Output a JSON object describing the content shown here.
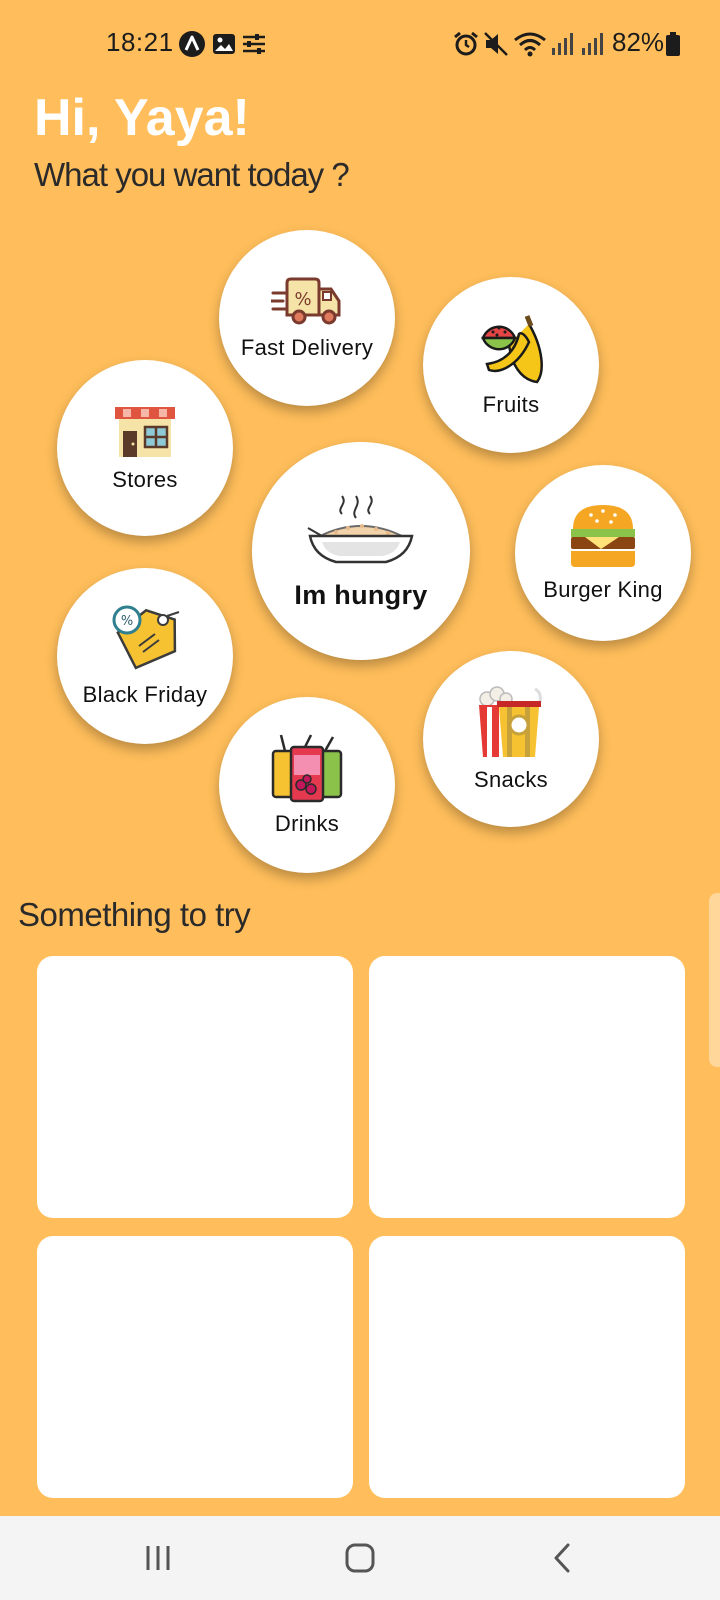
{
  "status_bar": {
    "time": "18:21",
    "battery": "82%",
    "left_icons": [
      "navigation-app-icon",
      "gallery-icon",
      "sliders-icon"
    ],
    "right_icons": [
      "alarm-icon",
      "mute-icon",
      "wifi-icon",
      "signal-icon",
      "signal-icon",
      "battery-icon"
    ]
  },
  "header": {
    "greeting": "Hi, Yaya!",
    "subtitle": "What you want today ?"
  },
  "categories": {
    "center": {
      "label": "Im hungry",
      "icon": "rice-bowl-icon"
    },
    "fast_delivery": {
      "label": "Fast Delivery",
      "icon": "delivery-truck-icon"
    },
    "fruits": {
      "label": "Fruits",
      "icon": "fruits-icon"
    },
    "stores": {
      "label": "Stores",
      "icon": "store-icon"
    },
    "burger_king": {
      "label": "Burger King",
      "icon": "burger-icon"
    },
    "black_friday": {
      "label": "Black Friday",
      "icon": "discount-tag-icon"
    },
    "drinks": {
      "label": "Drinks",
      "icon": "drinks-icon"
    },
    "snacks": {
      "label": "Snacks",
      "icon": "popcorn-icon"
    }
  },
  "section": {
    "title": "Something to try",
    "card_count": 4
  },
  "colors": {
    "background": "#FFBE5B",
    "card": "#FFFFFF",
    "nav_bar": "#F4F4F4"
  },
  "nav_bar": {
    "buttons": [
      "recent-apps-icon",
      "home-icon",
      "back-icon"
    ]
  }
}
